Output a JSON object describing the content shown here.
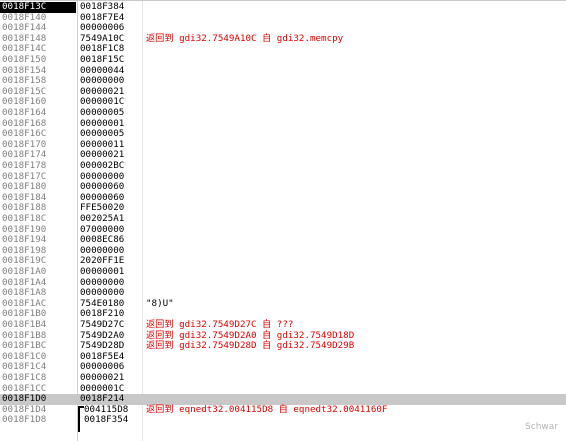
{
  "stack": {
    "rows": [
      {
        "address": "0018F13C",
        "value": "0018F384",
        "comment": ""
      },
      {
        "address": "0018F140",
        "value": "0018F7E4",
        "comment": ""
      },
      {
        "address": "0018F144",
        "value": "00000006",
        "comment": ""
      },
      {
        "address": "0018F148",
        "value": "7549A10C",
        "comment": "返回到 gdi32.7549A10C 自 gdi32.memcpy"
      },
      {
        "address": "0018F14C",
        "value": "0018F1C8",
        "comment": ""
      },
      {
        "address": "0018F150",
        "value": "0018F15C",
        "comment": ""
      },
      {
        "address": "0018F154",
        "value": "00000044",
        "comment": ""
      },
      {
        "address": "0018F158",
        "value": "00000000",
        "comment": ""
      },
      {
        "address": "0018F15C",
        "value": "00000021",
        "comment": ""
      },
      {
        "address": "0018F160",
        "value": "0000001C",
        "comment": ""
      },
      {
        "address": "0018F164",
        "value": "00000005",
        "comment": ""
      },
      {
        "address": "0018F168",
        "value": "00000001",
        "comment": ""
      },
      {
        "address": "0018F16C",
        "value": "00000005",
        "comment": ""
      },
      {
        "address": "0018F170",
        "value": "00000011",
        "comment": ""
      },
      {
        "address": "0018F174",
        "value": "00000021",
        "comment": ""
      },
      {
        "address": "0018F178",
        "value": "000002BC",
        "comment": ""
      },
      {
        "address": "0018F17C",
        "value": "00000000",
        "comment": ""
      },
      {
        "address": "0018F180",
        "value": "00000060",
        "comment": ""
      },
      {
        "address": "0018F184",
        "value": "00000060",
        "comment": ""
      },
      {
        "address": "0018F188",
        "value": "FFE50020",
        "comment": ""
      },
      {
        "address": "0018F18C",
        "value": "002025A1",
        "comment": ""
      },
      {
        "address": "0018F190",
        "value": "07000000",
        "comment": ""
      },
      {
        "address": "0018F194",
        "value": "0008EC86",
        "comment": ""
      },
      {
        "address": "0018F198",
        "value": "00000000",
        "comment": ""
      },
      {
        "address": "0018F19C",
        "value": "2020FF1E",
        "comment": ""
      },
      {
        "address": "0018F1A0",
        "value": "00000001",
        "comment": ""
      },
      {
        "address": "0018F1A4",
        "value": "00000000",
        "comment": ""
      },
      {
        "address": "0018F1A8",
        "value": "00000000",
        "comment": ""
      },
      {
        "address": "0018F1AC",
        "value": "754E0180",
        "comment": "\"8)U\""
      },
      {
        "address": "0018F1B0",
        "value": "0018F210",
        "comment": ""
      },
      {
        "address": "0018F1B4",
        "value": "7549D27C",
        "comment": "返回到 gdi32.7549D27C 自 ???"
      },
      {
        "address": "0018F1B8",
        "value": "7549D2A0",
        "comment": "返回到 gdi32.7549D2A0 自 gdi32.7549D18D"
      },
      {
        "address": "0018F1BC",
        "value": "7549D28D",
        "comment": "返回到 gdi32.7549D28D 自 gdi32.7549D29B"
      },
      {
        "address": "0018F1C0",
        "value": "0018F5E4",
        "comment": ""
      },
      {
        "address": "0018F1C4",
        "value": "00000006",
        "comment": ""
      },
      {
        "address": "0018F1C8",
        "value": "00000021",
        "comment": ""
      },
      {
        "address": "0018F1CC",
        "value": "0000001C",
        "comment": ""
      },
      {
        "address": "0018F1D0",
        "value": "0018F214",
        "comment": ""
      },
      {
        "address": "0018F1D4",
        "value": "004115D8",
        "comment": "返回到 eqnedt32.004115D8 自 eqnedt32.0041160F"
      },
      {
        "address": "0018F1D8",
        "value": "0018F354",
        "comment": ""
      }
    ]
  },
  "watermark": "Schwar",
  "colors": {
    "return_comment": "#e00000",
    "address_text": "#808080",
    "selected_bg": "#000000",
    "highlight_bg": "#c8c8c8"
  }
}
